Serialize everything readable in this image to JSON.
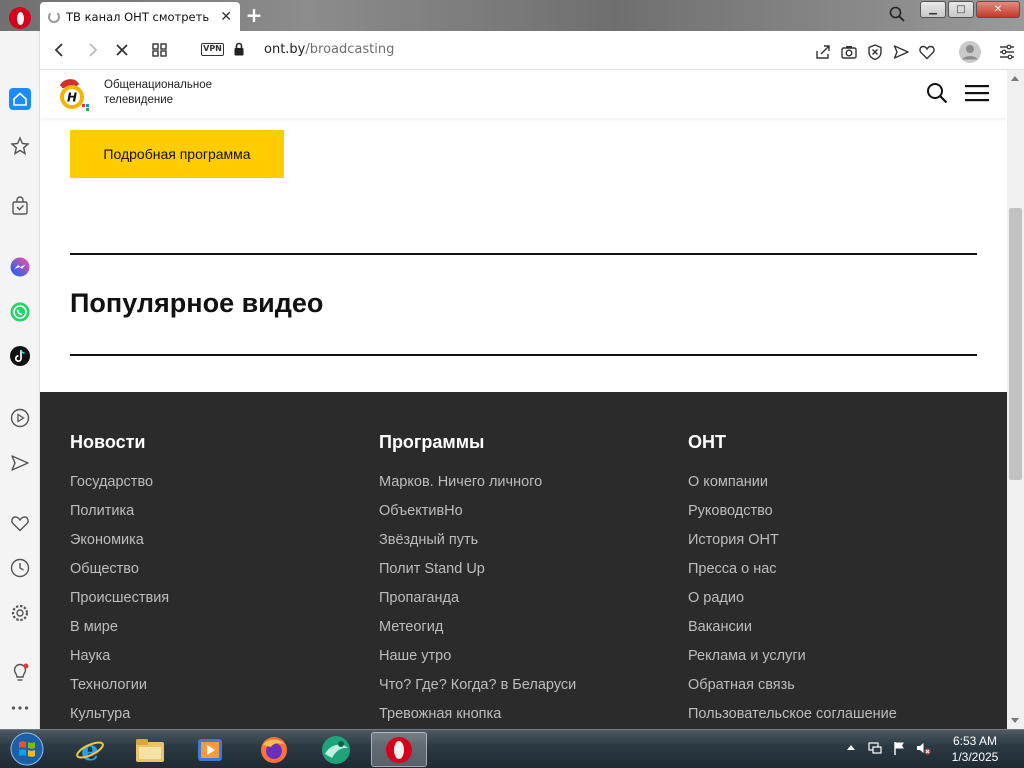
{
  "browser": {
    "tab_title": "ТВ канал ОНТ смотреть | с",
    "tab_close": "✕",
    "new_tab": "+",
    "vpn_label": "VPN",
    "url_host": "ont.by",
    "url_path": "/broadcasting",
    "window_controls": {
      "minimize": "▁",
      "maximize": "□",
      "close": "✕"
    }
  },
  "site": {
    "name_line1": "Общенациональное",
    "name_line2": "телевидение",
    "program_button": "Подробная программа",
    "popular_video_title": "Популярное видео"
  },
  "footer": {
    "columns": [
      {
        "title": "Новости",
        "links": [
          "Государство",
          "Политика",
          "Экономика",
          "Общество",
          "Происшествия",
          "В мире",
          "Наука",
          "Технологии",
          "Культура"
        ]
      },
      {
        "title": "Программы",
        "links": [
          "Марков. Ничего личного",
          "ОбъективНо",
          "Звёздный путь",
          "Полит Stand Up",
          "Пропаганда",
          "Метеогид",
          "Наше утро",
          "Что? Где? Когда? в Беларуси",
          "Тревожная кнопка"
        ]
      },
      {
        "title": "ОНТ",
        "links": [
          "О компании",
          "Руководство",
          "История ОНТ",
          "Пресса о нас",
          "О радио",
          "Вакансии",
          "Реклама и услуги",
          "Обратная связь",
          "Пользовательское соглашение"
        ]
      }
    ]
  },
  "taskbar": {
    "time": "6:53 AM",
    "date": "1/3/2025"
  },
  "colors": {
    "accent_yellow": "#ffcc00",
    "footer_bg": "#2b2b2b",
    "opera_red": "#d5011d"
  }
}
